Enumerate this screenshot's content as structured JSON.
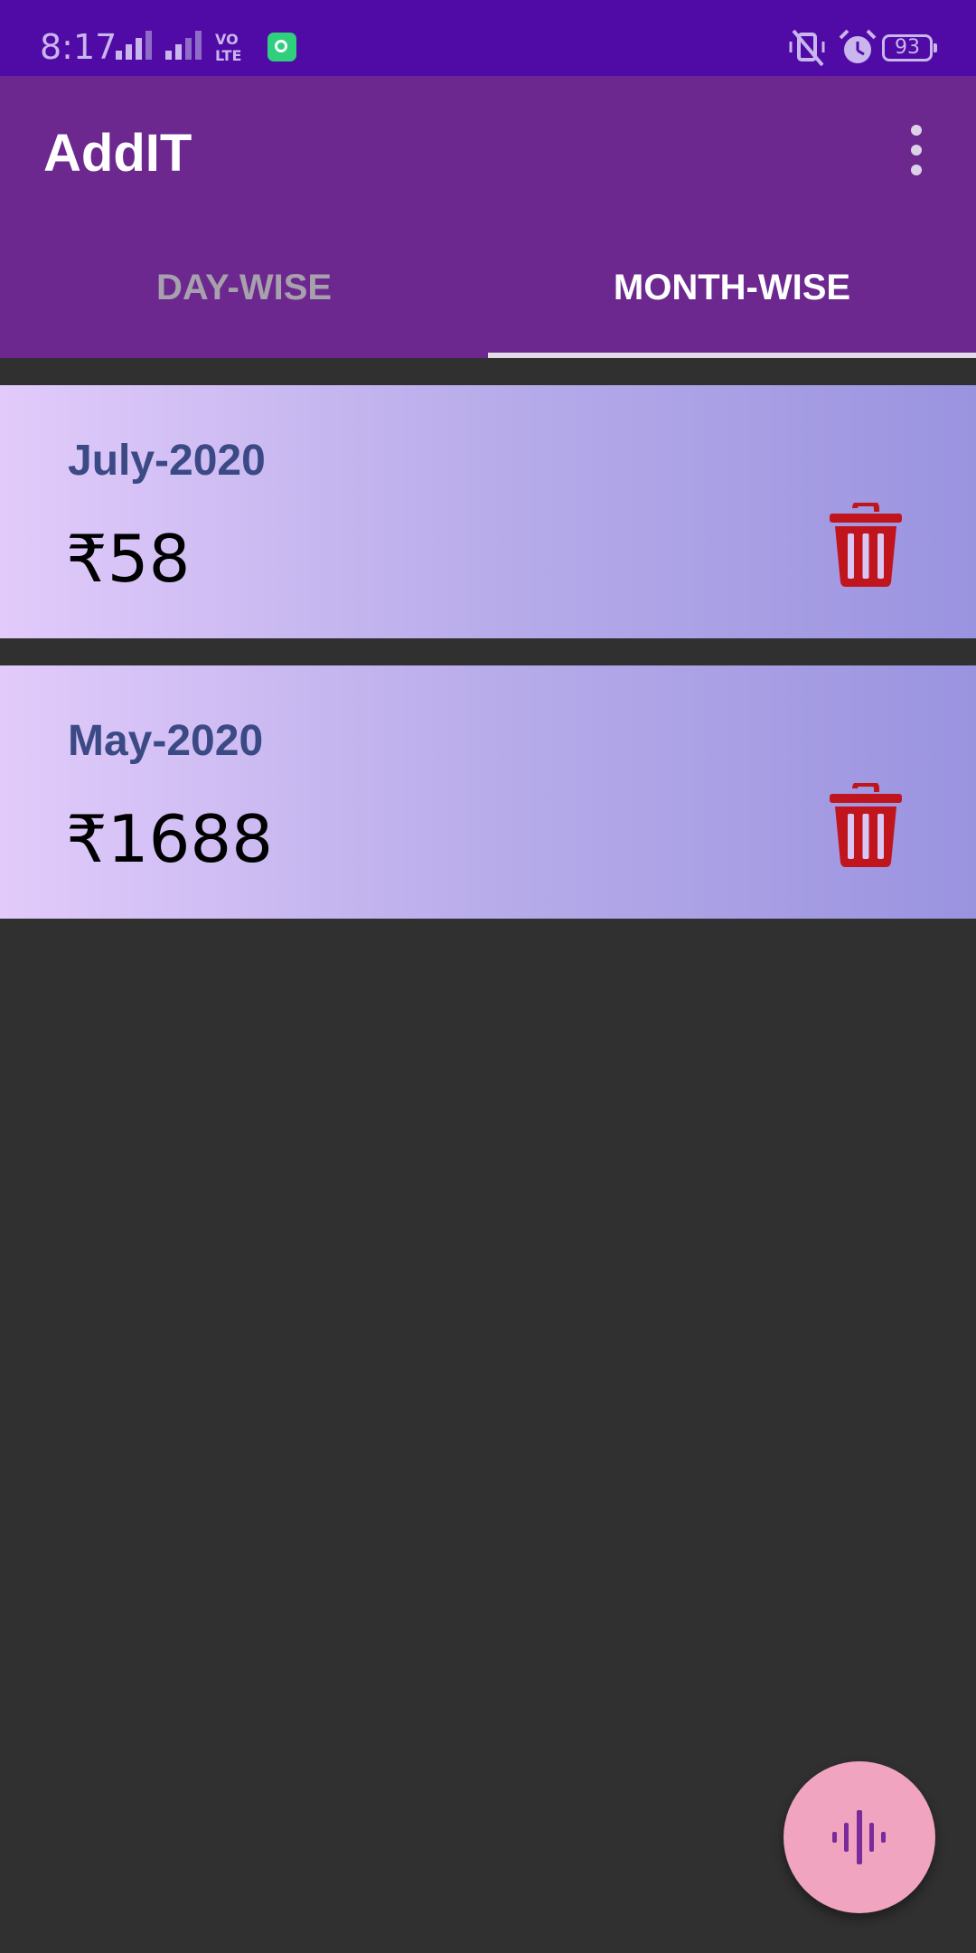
{
  "status_bar": {
    "time": "8:17",
    "network": "VO LTE",
    "battery": "93"
  },
  "app_bar": {
    "title": "AddIT"
  },
  "tabs": [
    {
      "label": "DAY-WISE",
      "selected": false
    },
    {
      "label": "MONTH-WISE",
      "selected": true
    }
  ],
  "cards": [
    {
      "month": "July-2020",
      "amount": "₹58"
    },
    {
      "month": "May-2020",
      "amount": "₹1688"
    }
  ],
  "colors": {
    "status_bar": "#500aa6",
    "app_bar": "#6d288f",
    "background": "#303030",
    "card_title": "#3b4a85",
    "delete": "#c0151d",
    "fab": "#f0a4c0",
    "fab_icon": "#7a2a9a"
  },
  "icons": {
    "overflow": "more-vert-icon",
    "delete": "trash-icon",
    "fab": "voice-waveform-icon"
  }
}
